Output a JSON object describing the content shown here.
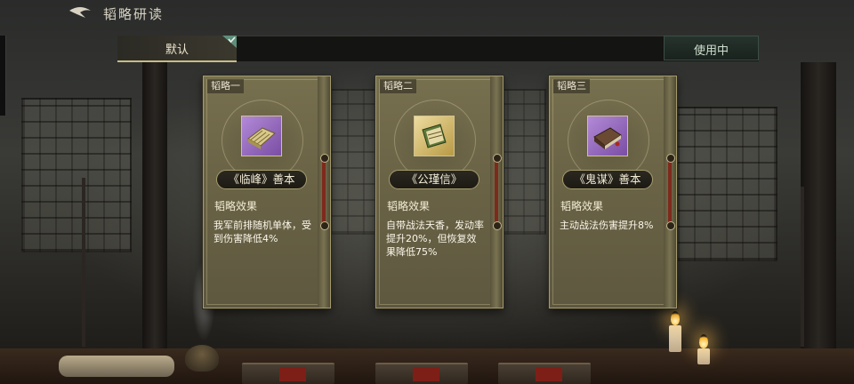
{
  "header": {
    "title": "韬略研读"
  },
  "topbar": {
    "default_tab": "默认",
    "in_use_button": "使用中"
  },
  "cards": [
    {
      "slot": "韬略一",
      "item_name": "《临峰》善本",
      "item_color": "purple",
      "effect_label": "韬略效果",
      "effect": "我军前排随机单体，受到伤害降低4%"
    },
    {
      "slot": "韬略二",
      "item_name": "《公瑾信》",
      "item_color": "gold",
      "effect_label": "韬略效果",
      "effect": "自带战法天香，发动率提升20%，但恢复效果降低75%"
    },
    {
      "slot": "韬略三",
      "item_name": "《鬼谋》善本",
      "item_color": "purple",
      "effect_label": "韬略效果",
      "effect": "主动战法伤害提升8%"
    }
  ],
  "icons": {
    "back": "back-arrow-icon",
    "check": "check-icon"
  }
}
